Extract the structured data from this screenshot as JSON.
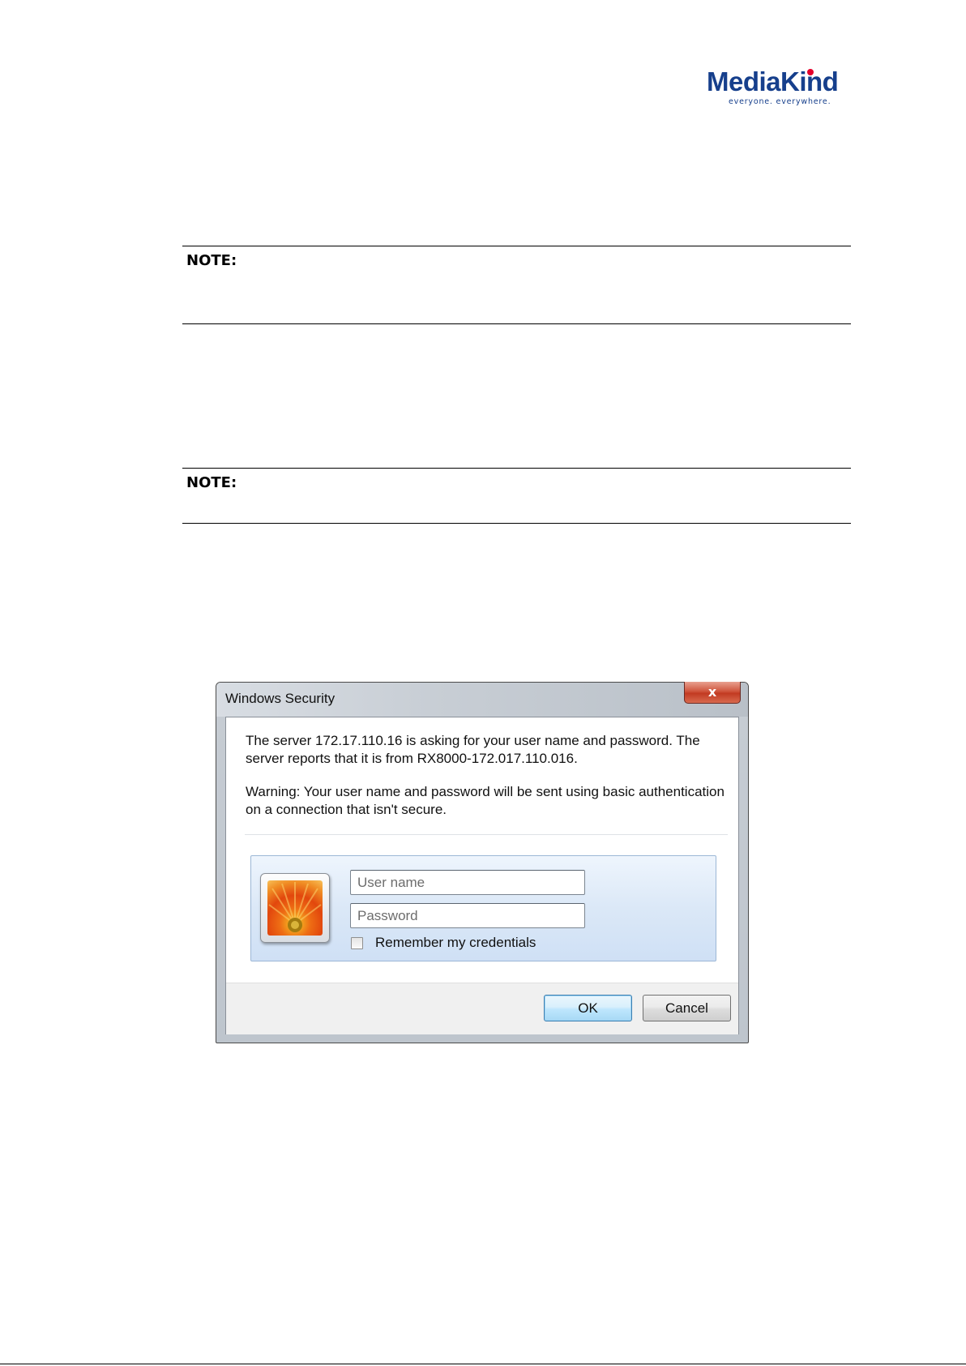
{
  "logo": {
    "brand": "MediaKind",
    "tagline": "everyone. everywhere.",
    "brand_color": "#163f8c",
    "accent_color": "#e4002b"
  },
  "notes": [
    {
      "label": "NOTE:"
    },
    {
      "label": "NOTE:"
    }
  ],
  "dialog": {
    "title": "Windows Security",
    "close_glyph": "x",
    "message": "The server 172.17.110.16 is asking for your user name and password. The server reports that it is from RX8000-172.017.110.016.",
    "warning": "Warning: Your user name and password will be sent using basic authentication on a connection that isn't secure.",
    "username": {
      "placeholder": "User name",
      "value": ""
    },
    "password": {
      "placeholder": "Password",
      "value": ""
    },
    "remember_label": "Remember my credentials",
    "remember_checked": false,
    "ok_label": "OK",
    "cancel_label": "Cancel",
    "avatar_icon": "flower-picture-icon"
  }
}
